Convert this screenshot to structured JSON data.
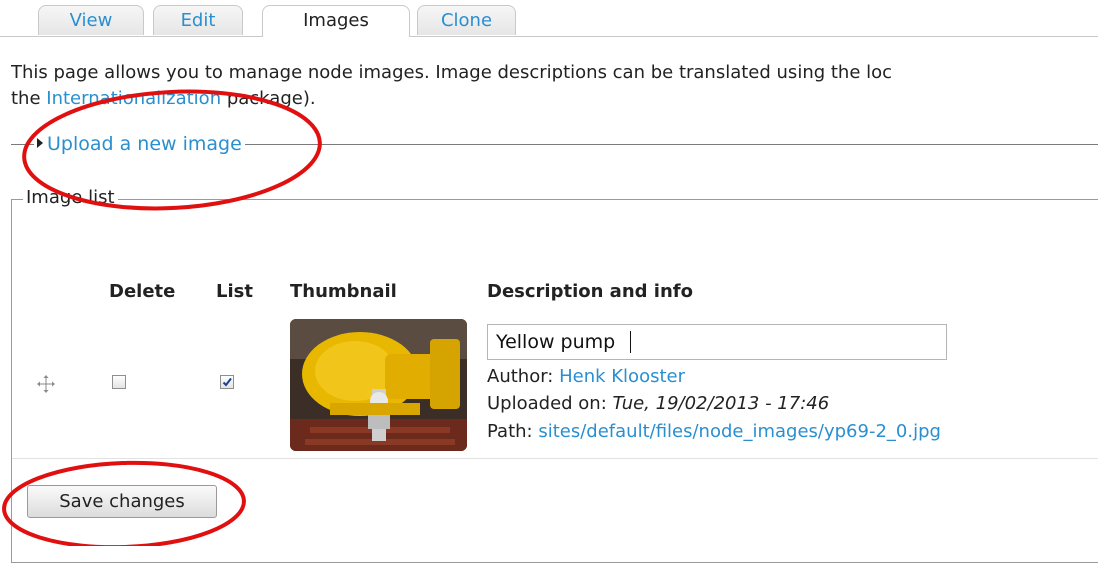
{
  "tabs": [
    {
      "label": "View",
      "active": false
    },
    {
      "label": "Edit",
      "active": false
    },
    {
      "label": "Images",
      "active": true
    },
    {
      "label": "Clone",
      "active": false
    }
  ],
  "intro": {
    "text_before_link": "This page allows you to manage node images. Image descriptions can be translated using the loc",
    "text_line2_before": "the ",
    "link_text": "Internationalization",
    "text_after_link": " package)."
  },
  "upload": {
    "legend": "Upload a new image",
    "collapsed": true
  },
  "image_list": {
    "legend": "Image list",
    "columns": [
      "Delete",
      "List",
      "Thumbnail",
      "Description and info"
    ],
    "rows": [
      {
        "delete_checked": false,
        "list_checked": true,
        "description": "Yellow pump",
        "author_label": "Author:",
        "author_name": "Henk Klooster",
        "uploaded_label": "Uploaded on:",
        "uploaded_value": "Tue, 19/02/2013 - 17:46",
        "path_label": "Path:",
        "path_value": "sites/default/files/node_images/yp69-2_0.jpg"
      }
    ]
  },
  "actions": {
    "save_label": "Save changes"
  },
  "colors": {
    "link": "#2a8fd0",
    "annotation": "#e01010",
    "pump_yellow": "#e8b700"
  },
  "icons": {
    "drag": "move-arrows-icon",
    "collapse": "triangle-right-icon"
  }
}
